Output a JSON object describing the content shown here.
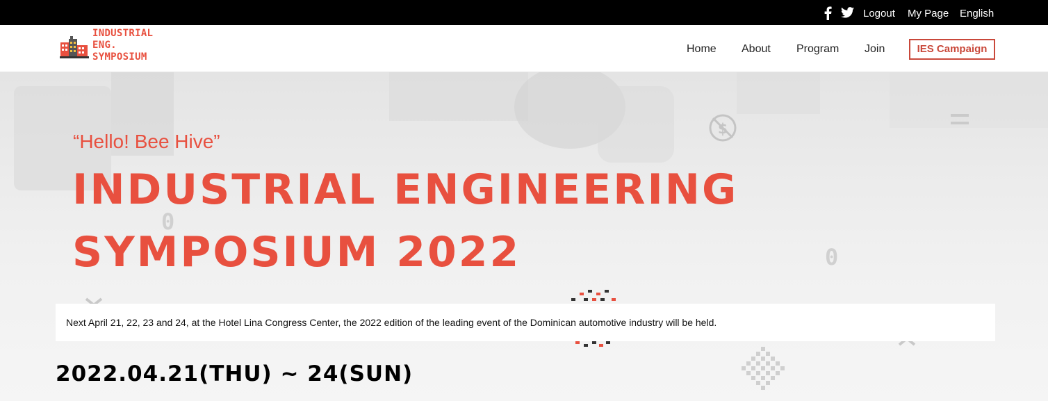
{
  "topbar": {
    "social": [
      {
        "icon": "facebook-icon"
      },
      {
        "icon": "twitter-icon"
      }
    ],
    "logout_label": "Logout",
    "mypage_label": "My Page",
    "language_label": "English"
  },
  "header": {
    "logo_lines": [
      "INDUSTRIAL",
      "ENG.",
      "SYMPOSIUM"
    ],
    "nav": [
      "Home",
      "About",
      "Program",
      "Join"
    ],
    "campaign_label": "IES Campaign"
  },
  "hero": {
    "subtitle": "“Hello! Bee Hive”",
    "title": "INDUSTRIAL ENGINEERING SYMPOSIUM 2022",
    "notice": "Next April 21, 22, 23 and 24, at the Hotel Lina Congress Center, the 2022 edition of the leading event of the Dominican automotive industry will be held.",
    "dates": "2022.04.21(THU) ~ 24(SUN)"
  },
  "colors": {
    "accent": "#e8503f",
    "topbar_bg": "#000000",
    "header_bg": "#ffffff"
  }
}
